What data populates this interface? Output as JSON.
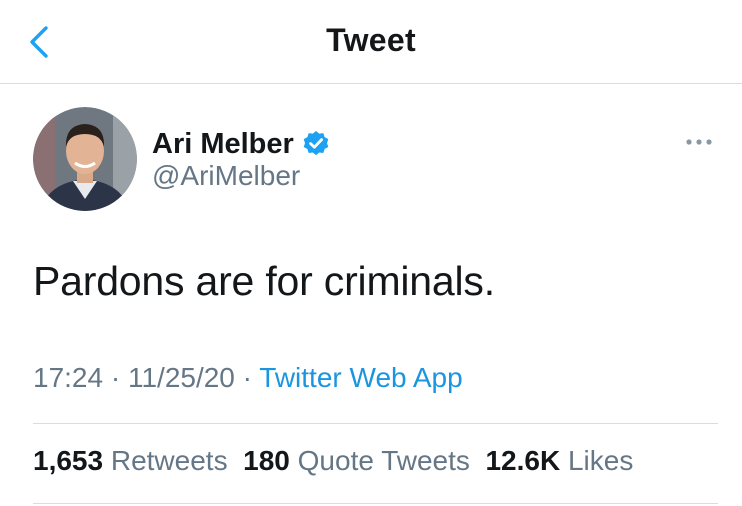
{
  "nav": {
    "title": "Tweet",
    "back_icon": "chevron-left-icon"
  },
  "author": {
    "name": "Ari Melber",
    "handle": "@AriMelber",
    "verified_icon": "verified-badge-icon",
    "more_icon": "more-dots-icon"
  },
  "tweet": {
    "text": "Pardons are for criminals.",
    "time": "17:24",
    "date": "11/25/20",
    "separator": " · ",
    "source": "Twitter Web App"
  },
  "stats": {
    "retweets": {
      "count": "1,653",
      "label": "Retweets"
    },
    "quotes": {
      "count": "180",
      "label": "Quote Tweets"
    },
    "likes": {
      "count": "12.6K",
      "label": "Likes"
    }
  },
  "colors": {
    "accent": "#1b95e0",
    "verified": "#1da1f2",
    "secondary_text": "#657786",
    "divider": "#d8dde1"
  }
}
